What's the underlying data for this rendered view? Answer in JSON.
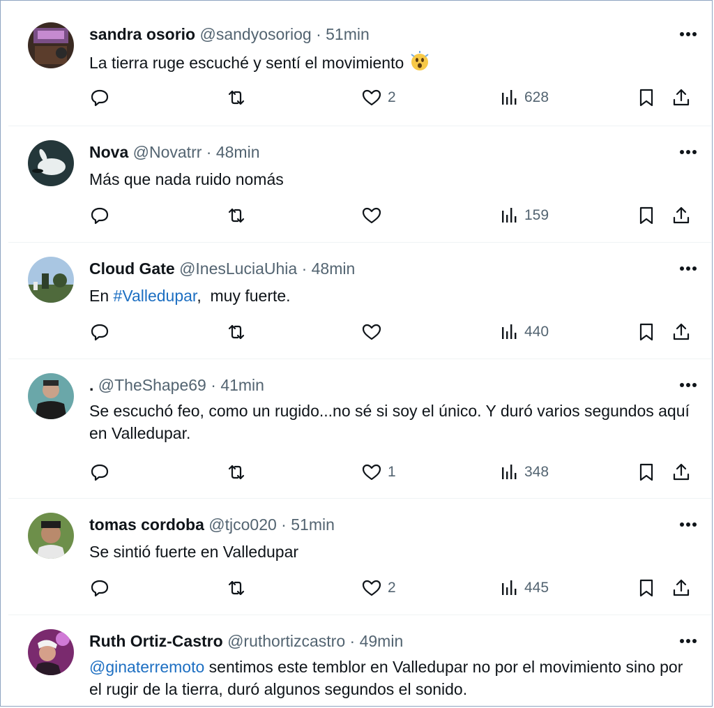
{
  "tweets": [
    {
      "name": "sandra osorio",
      "handle": "@sandyosoriog",
      "time": "51min",
      "text": "La tierra ruge escuché y sentí el movimiento",
      "has_emoji": true,
      "likes": "2",
      "views": "628"
    },
    {
      "name": "Nova",
      "handle": "@Novatrr",
      "time": "48min",
      "text": "Más que nada ruido nomás",
      "likes": "",
      "views": "159"
    },
    {
      "name": "Cloud Gate",
      "handle": "@InesLuciaUhia",
      "time": "48min",
      "text_prefix": "En ",
      "text_link": "#Valledupar",
      "text_suffix": ",  muy fuerte.",
      "likes": "",
      "views": "440"
    },
    {
      "name": ".",
      "handle": "@TheShape69",
      "time": "41min",
      "text": "Se escuchó feo, como un rugido...no sé si soy el único. Y duró varios segundos aquí en Valledupar.",
      "likes": "1",
      "views": "348"
    },
    {
      "name": "tomas cordoba",
      "handle": "@tjco020",
      "time": "51min",
      "text": "Se sintió fuerte en Valledupar",
      "likes": "2",
      "views": "445"
    },
    {
      "name": "Ruth Ortiz-Castro",
      "handle": "@ruthortizcastro",
      "time": "49min",
      "text_link": "@ginaterremoto",
      "text_suffix": " sentimos este temblor en Valledupar no por el movimiento sino por el rugir de la tierra, duró algunos segundos el sonido."
    }
  ],
  "separator": "·",
  "colors": {
    "link": "#1d6fc2",
    "secondary": "#536471",
    "primary": "#0f1419"
  }
}
